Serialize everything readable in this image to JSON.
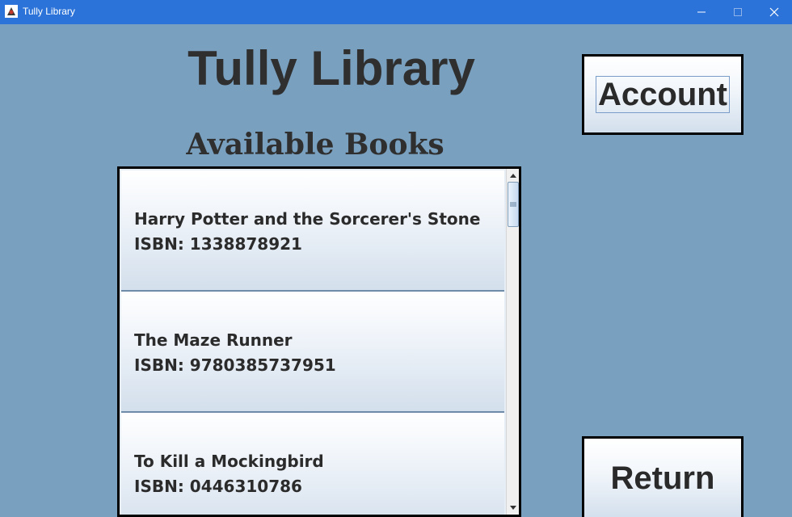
{
  "window": {
    "title": "Tully Library",
    "icon": "app-icon",
    "controls": [
      "minimize-icon",
      "maximize-icon",
      "close-icon"
    ]
  },
  "header": {
    "title": "Tully Library",
    "subtitle": "Available Books"
  },
  "buttons": {
    "account_label": "Account",
    "return_label": "Return"
  },
  "books": [
    {
      "title": "Harry Potter and the Sorcerer's Stone",
      "isbn": "ISBN: 1338878921"
    },
    {
      "title": "The Maze Runner",
      "isbn": "ISBN: 9780385737951"
    },
    {
      "title": "To Kill a Mockingbird",
      "isbn": "ISBN: 0446310786"
    }
  ],
  "colors": {
    "background": "#7aa0bf",
    "titlebar": "#2b73d8",
    "text": "#2f2f2f"
  }
}
